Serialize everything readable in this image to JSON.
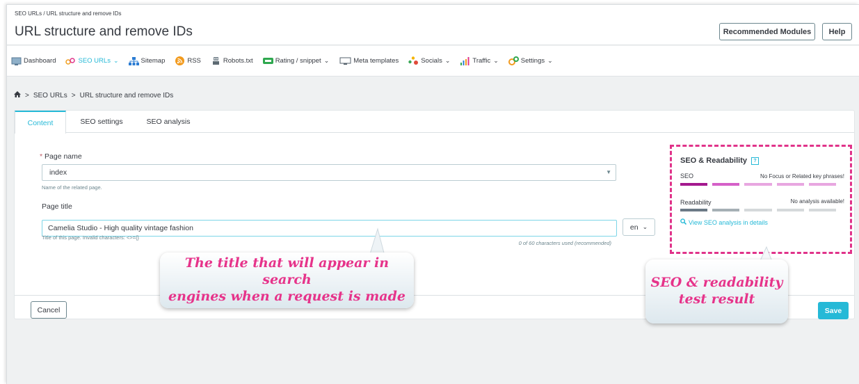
{
  "header": {
    "breadcrumb": "SEO URLs / URL structure and remove IDs",
    "title": "URL structure and remove IDs",
    "recommended_label": "Recommended Modules",
    "help_label": "Help"
  },
  "nav": {
    "items": [
      {
        "label": "Dashboard",
        "icon": "dashboard-icon",
        "caret": false
      },
      {
        "label": "SEO URLs",
        "icon": "seo-urls-icon",
        "caret": true,
        "active": true
      },
      {
        "label": "Sitemap",
        "icon": "sitemap-icon",
        "caret": false
      },
      {
        "label": "RSS",
        "icon": "rss-icon",
        "caret": false
      },
      {
        "label": "Robots.txt",
        "icon": "robot-icon",
        "caret": false
      },
      {
        "label": "Rating / snippet",
        "icon": "rating-icon",
        "caret": true
      },
      {
        "label": "Meta templates",
        "icon": "monitor-icon",
        "caret": false
      },
      {
        "label": "Socials",
        "icon": "socials-icon",
        "caret": true
      },
      {
        "label": "Traffic",
        "icon": "traffic-icon",
        "caret": true
      },
      {
        "label": "Settings",
        "icon": "settings-icon",
        "caret": true
      }
    ]
  },
  "breadcrumb": {
    "home_icon": "home-icon",
    "level1": "SEO URLs",
    "level2": "URL structure and remove IDs",
    "separator": ">"
  },
  "tabs": [
    "Content",
    "SEO settings",
    "SEO analysis"
  ],
  "form": {
    "page_name_required": "*",
    "page_name_label": "Page name",
    "page_name_value": "index",
    "page_name_hint": "Name of the related page.",
    "page_title_label": "Page title",
    "page_title_value": "Camelia Studio - High quality vintage fashion",
    "page_title_hint": "Title of this page. Invalid characters: <>={}",
    "lang": "en",
    "counter": "0 of 60 characters used (recommended)",
    "cancel_label": "Cancel",
    "save_label": "Save"
  },
  "seo_panel": {
    "title": "SEO & Readability",
    "help_glyph": "?",
    "seo_label": "SEO",
    "seo_message": "No Focus or Related key phrases!",
    "readability_label": "Readability",
    "readability_message": "No analysis available!",
    "link": "View SEO analysis in details",
    "seo_bar_colors": [
      "#a4198e",
      "#d560c8",
      "#e8a6e0",
      "#e8a6e0",
      "#e8a6e0"
    ],
    "readability_bar_colors": [
      "#6c7a86",
      "#a6b0b5",
      "#d5d9db",
      "#d5d9db",
      "#d5d9db"
    ]
  },
  "callouts": {
    "title_note_line1": "The title that will appear in search",
    "title_note_line2": "engines when a request is made",
    "seo_note_line1": "SEO & readability",
    "seo_note_line2": "test result"
  },
  "colors": {
    "accent": "#25b9d7",
    "highlight": "#e0338a"
  }
}
